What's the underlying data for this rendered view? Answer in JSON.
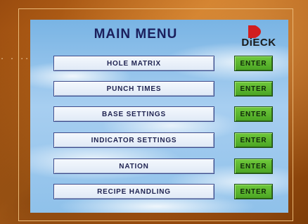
{
  "decoration": {
    "dots": ". . .."
  },
  "menu": {
    "title": "MAIN MENU",
    "logo": {
      "text": "DiECK",
      "color": "#d11e1e"
    },
    "enter_label": "ENTER",
    "items": [
      {
        "id": "hole-matrix",
        "label": "HOLE MATRIX"
      },
      {
        "id": "punch-times",
        "label": "PUNCH TIMES"
      },
      {
        "id": "base-settings",
        "label": "BASE SETTINGS"
      },
      {
        "id": "indicator-settings",
        "label": "INDICATOR SETTINGS"
      },
      {
        "id": "nation",
        "label": "NATION"
      },
      {
        "id": "recipe-handling",
        "label": "RECIPE HANDLING"
      }
    ]
  },
  "colors": {
    "enter_green": "#5bb52e",
    "item_text": "#1e2250",
    "frame_orange": "#c9721e"
  }
}
